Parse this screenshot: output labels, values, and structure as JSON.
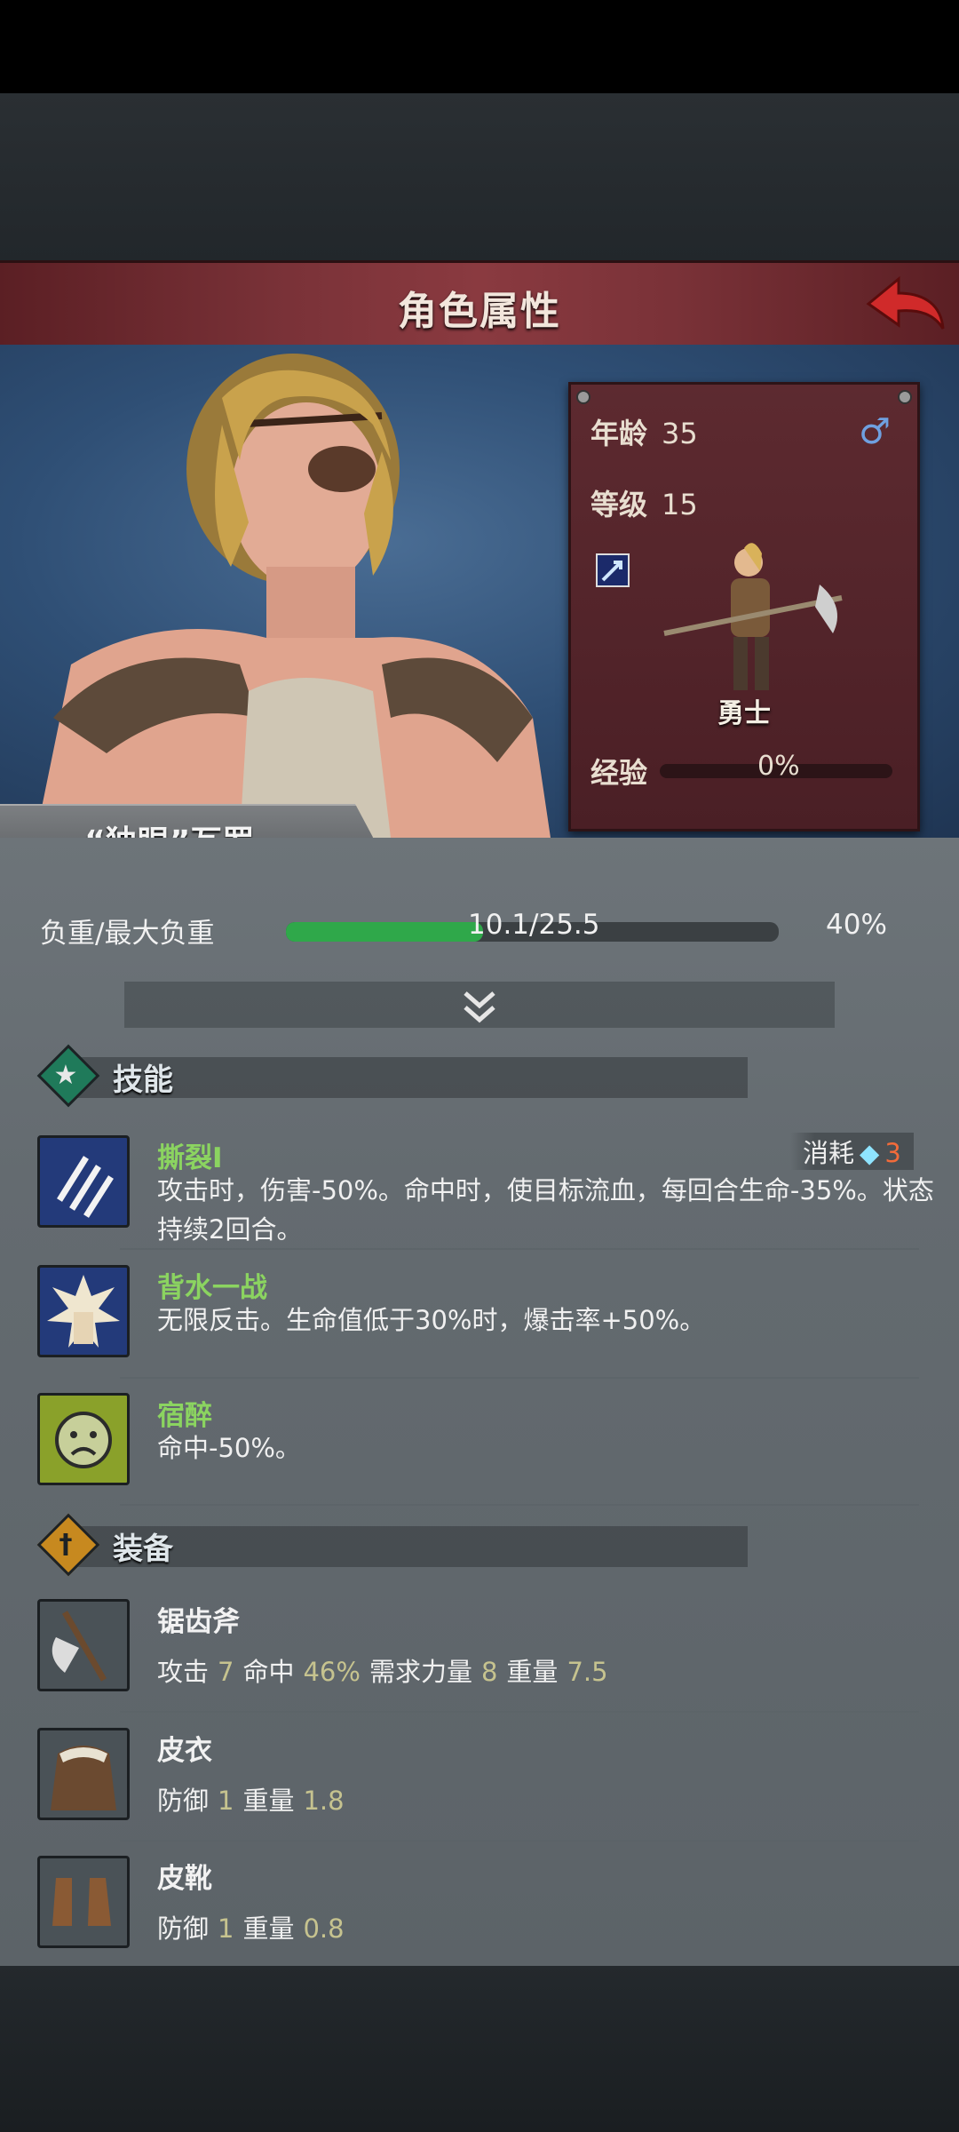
{
  "header": {
    "title": "角色属性"
  },
  "hero": {
    "name": "“独眼”瓦罗",
    "age_label": "年龄",
    "age": "35",
    "level_label": "等级",
    "level": "15",
    "gender_icon": "male-icon",
    "class": "勇士",
    "exp_label": "经验",
    "exp_value": "0%"
  },
  "load": {
    "label": "负重/最大负重",
    "value": "10.1/25.5",
    "percent_text": "40%",
    "fill_fraction": 0.4
  },
  "skills": {
    "section_title": "技能",
    "cost_label": "消耗",
    "cost_value": "3",
    "items": [
      {
        "name": "撕裂I",
        "desc": "攻击时，伤害-50%。命中时，使目标流血，每回合生命-35%。状态持续2回合。",
        "icon": "claw-slash-icon"
      },
      {
        "name": "背水一战",
        "desc": "无限反击。生命值低于30%时，爆击率+50%。",
        "icon": "fist-burst-icon"
      },
      {
        "name": "宿醉",
        "desc": "命中-50%。",
        "icon": "sick-face-icon"
      }
    ]
  },
  "equipment": {
    "section_title": "装备",
    "items": [
      {
        "name": "锯齿斧",
        "stats": [
          {
            "k": "攻击",
            "v": "7"
          },
          {
            "k": "命中",
            "v": "46%"
          },
          {
            "k": "需求力量",
            "v": "8"
          },
          {
            "k": "重量",
            "v": "7.5"
          }
        ]
      },
      {
        "name": "皮衣",
        "stats": [
          {
            "k": "防御",
            "v": "1"
          },
          {
            "k": "重量",
            "v": "1.8"
          }
        ]
      },
      {
        "name": "皮靴",
        "stats": [
          {
            "k": "防御",
            "v": "1"
          },
          {
            "k": "重量",
            "v": "0.8"
          }
        ]
      }
    ]
  },
  "colors": {
    "skill_name": "#8bd460",
    "title_bar": "#7a3238",
    "accent_green": "#2fa84a"
  }
}
